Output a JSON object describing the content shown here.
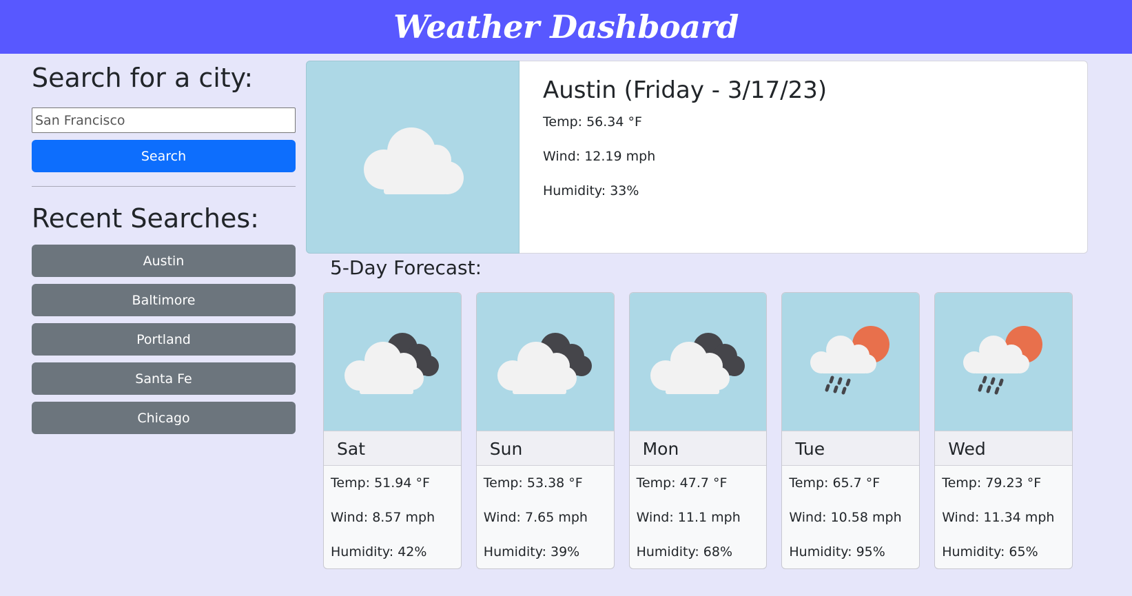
{
  "header": {
    "title": "Weather Dashboard"
  },
  "sidebar": {
    "search_title": "Search for a city:",
    "search_input_value": "San Francisco",
    "search_button_label": "Search",
    "recent_title": "Recent Searches:",
    "recent": [
      "Austin",
      "Baltimore",
      "Portland",
      "Santa Fe",
      "Chicago"
    ]
  },
  "current": {
    "city_line": "Austin (Friday - 3/17/23)",
    "temp": "Temp: 56.34 °F",
    "wind": "Wind: 12.19 mph",
    "humidity": "Humidity: 33%",
    "icon": "cloud-icon"
  },
  "forecast": {
    "title": "5-Day Forecast:",
    "days": [
      {
        "day": "Sat",
        "temp": "Temp: 51.94 °F",
        "wind": "Wind: 8.57 mph",
        "humidity": "Humidity: 42%",
        "icon": "broken-clouds-icon"
      },
      {
        "day": "Sun",
        "temp": "Temp: 53.38 °F",
        "wind": "Wind: 7.65 mph",
        "humidity": "Humidity: 39%",
        "icon": "broken-clouds-icon"
      },
      {
        "day": "Mon",
        "temp": "Temp: 47.7 °F",
        "wind": "Wind: 11.1 mph",
        "humidity": "Humidity: 68%",
        "icon": "broken-clouds-icon"
      },
      {
        "day": "Tue",
        "temp": "Temp: 65.7 °F",
        "wind": "Wind: 10.58 mph",
        "humidity": "Humidity: 95%",
        "icon": "rain-sun-icon"
      },
      {
        "day": "Wed",
        "temp": "Temp: 79.23 °F",
        "wind": "Wind: 11.34 mph",
        "humidity": "Humidity: 65%",
        "icon": "rain-sun-icon"
      }
    ]
  },
  "colors": {
    "header_bg": "#5858ff",
    "page_bg": "#e6e6fa",
    "primary_button": "#0d6efd",
    "secondary_button": "#6c757d",
    "icon_panel_bg": "#add8e6"
  }
}
